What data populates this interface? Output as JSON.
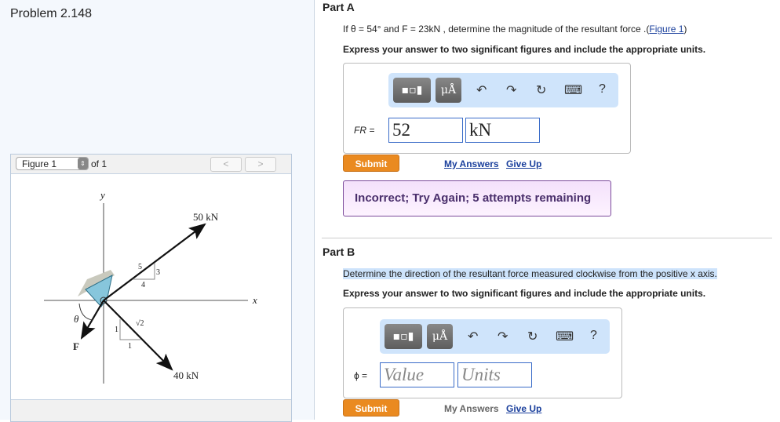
{
  "problem_title": "Problem 2.148",
  "figure": {
    "selector": "Figure 1",
    "of": "of 1",
    "prev": "<",
    "next": ">",
    "labels": {
      "y": "y",
      "x": "x",
      "f50": "50 kN",
      "f40": "40 kN",
      "F": "F",
      "theta": "θ",
      "s5": "5",
      "s3": "3",
      "s4": "4",
      "sqrt2": "√2",
      "one_a": "1",
      "one_b": "1"
    }
  },
  "partA": {
    "title": "Part A",
    "question": "If θ = 54° and F = 23kN , determine the magnitude of the resultant force .(",
    "fig_link": "Figure 1",
    "question_end": ")",
    "instruction": "Express your answer to two significant figures and include the appropriate units.",
    "var_label": "FR =",
    "value": "52",
    "units": "kN",
    "submit": "Submit",
    "my_answers": "My Answers",
    "give_up": "Give Up",
    "feedback": "Incorrect; Try Again; 5 attempts remaining"
  },
  "partB": {
    "title": "Part B",
    "question": "Determine the direction of the resultant force measured clockwise from the positive x axis.",
    "instruction": "Express your answer to two significant figures and include the appropriate units.",
    "var_label": "ϕ =",
    "value_placeholder": "Value",
    "units_placeholder": "Units",
    "submit": "Submit",
    "my_answers": "My Answers",
    "give_up": "Give Up"
  },
  "toolbar": {
    "units_btn": "μÅ",
    "undo": "↶",
    "redo": "↷",
    "reset": "↻",
    "keyboard": "⌨",
    "help": "?"
  }
}
